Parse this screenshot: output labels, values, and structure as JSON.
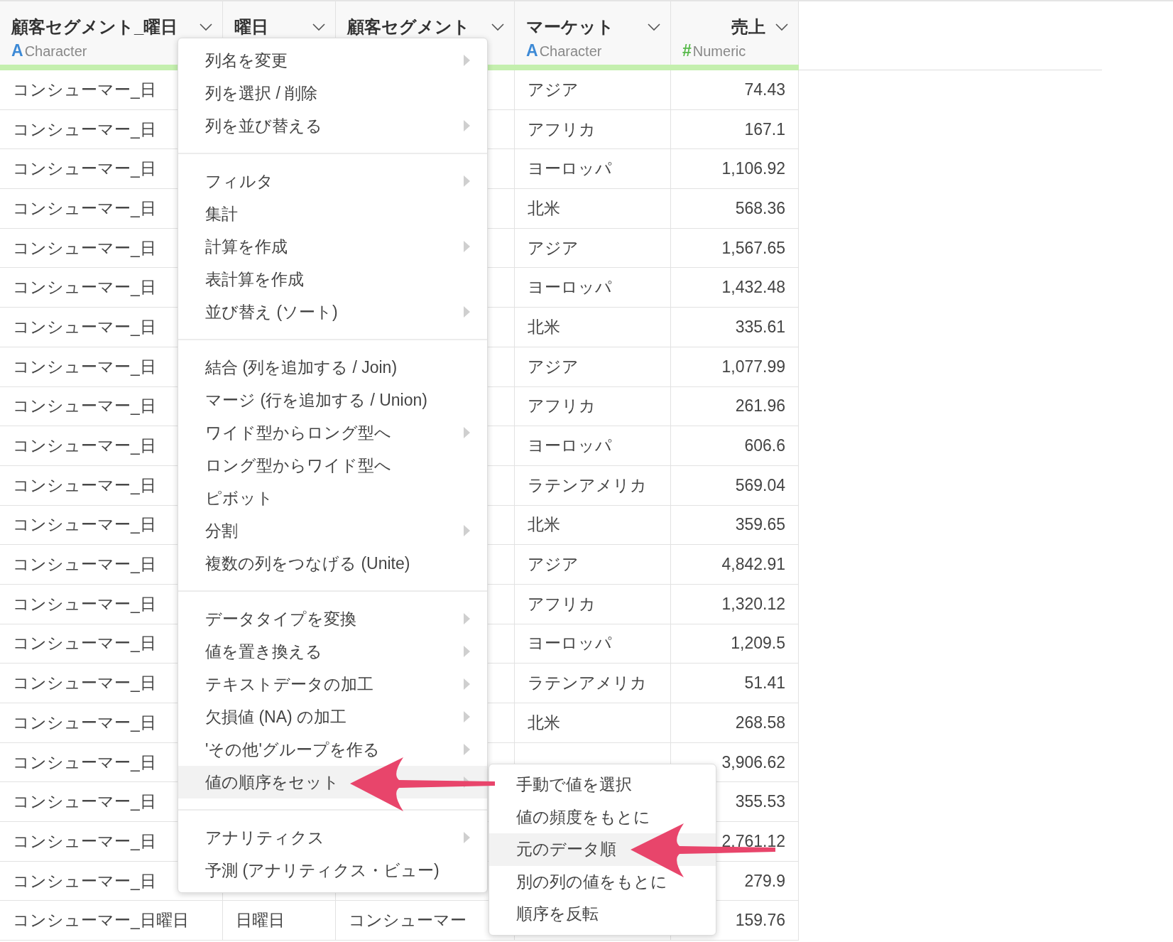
{
  "table": {
    "columns": [
      {
        "name": "顧客セグメント_曜日",
        "type": {
          "kind": "character",
          "icon": "A",
          "label": "Character"
        }
      },
      {
        "name": "曜日"
      },
      {
        "name": "顧客セグメント"
      },
      {
        "name": "マーケット",
        "type": {
          "kind": "character",
          "icon": "A",
          "label": "Character"
        }
      },
      {
        "name": "売上",
        "type": {
          "kind": "numeric",
          "icon": "#",
          "label": "Numeric"
        }
      }
    ],
    "rows": [
      {
        "cells": [
          "コンシューマー_日",
          "",
          "",
          "アジア",
          "74.43"
        ]
      },
      {
        "cells": [
          "コンシューマー_日",
          "",
          "",
          "アフリカ",
          "167.1"
        ]
      },
      {
        "cells": [
          "コンシューマー_日",
          "",
          "",
          "ヨーロッパ",
          "1,106.92"
        ]
      },
      {
        "cells": [
          "コンシューマー_日",
          "",
          "",
          "北米",
          "568.36"
        ]
      },
      {
        "cells": [
          "コンシューマー_日",
          "",
          "",
          "アジア",
          "1,567.65"
        ]
      },
      {
        "cells": [
          "コンシューマー_日",
          "",
          "",
          "ヨーロッパ",
          "1,432.48"
        ]
      },
      {
        "cells": [
          "コンシューマー_日",
          "",
          "",
          "北米",
          "335.61"
        ]
      },
      {
        "cells": [
          "コンシューマー_日",
          "",
          "",
          "アジア",
          "1,077.99"
        ]
      },
      {
        "cells": [
          "コンシューマー_日",
          "",
          "",
          "アフリカ",
          "261.96"
        ]
      },
      {
        "cells": [
          "コンシューマー_日",
          "",
          "",
          "ヨーロッパ",
          "606.6"
        ]
      },
      {
        "cells": [
          "コンシューマー_日",
          "",
          "",
          "ラテンアメリカ",
          "569.04"
        ]
      },
      {
        "cells": [
          "コンシューマー_日",
          "",
          "",
          "北米",
          "359.65"
        ]
      },
      {
        "cells": [
          "コンシューマー_日",
          "",
          "",
          "アジア",
          "4,842.91"
        ]
      },
      {
        "cells": [
          "コンシューマー_日",
          "",
          "",
          "アフリカ",
          "1,320.12"
        ]
      },
      {
        "cells": [
          "コンシューマー_日",
          "",
          "",
          "ヨーロッパ",
          "1,209.5"
        ]
      },
      {
        "cells": [
          "コンシューマー_日",
          "",
          "",
          "ラテンアメリカ",
          "51.41"
        ]
      },
      {
        "cells": [
          "コンシューマー_日",
          "",
          "",
          "北米",
          "268.58"
        ]
      },
      {
        "cells": [
          "コンシューマー_日",
          "",
          "",
          "",
          "3,906.62"
        ]
      },
      {
        "cells": [
          "コンシューマー_日",
          "",
          "",
          "",
          "355.53"
        ]
      },
      {
        "cells": [
          "コンシューマー_日",
          "",
          "",
          "",
          "2,761.12"
        ]
      },
      {
        "cells": [
          "コンシューマー_日",
          "",
          "",
          "",
          "279.9"
        ]
      },
      {
        "cells": [
          "コンシューマー_日曜日",
          "日曜日",
          "コンシューマー",
          "",
          "159.76"
        ]
      }
    ]
  },
  "context_menu": {
    "groups": [
      [
        {
          "label": "列名を変更",
          "submenu": true,
          "selected": false
        },
        {
          "label": "列を選択 / 削除",
          "submenu": false,
          "selected": false
        },
        {
          "label": "列を並び替える",
          "submenu": true,
          "selected": false
        }
      ],
      [
        {
          "label": "フィルタ",
          "submenu": true,
          "selected": false
        },
        {
          "label": "集計",
          "submenu": false,
          "selected": false
        },
        {
          "label": "計算を作成",
          "submenu": true,
          "selected": false
        },
        {
          "label": "表計算を作成",
          "submenu": false,
          "selected": false
        },
        {
          "label": "並び替え (ソート)",
          "submenu": true,
          "selected": false
        }
      ],
      [
        {
          "label": "結合 (列を追加する / Join)",
          "submenu": false,
          "selected": false
        },
        {
          "label": "マージ (行を追加する / Union)",
          "submenu": false,
          "selected": false
        },
        {
          "label": "ワイド型からロング型へ",
          "submenu": true,
          "selected": false
        },
        {
          "label": "ロング型からワイド型へ",
          "submenu": false,
          "selected": false
        },
        {
          "label": "ピボット",
          "submenu": false,
          "selected": false
        },
        {
          "label": "分割",
          "submenu": true,
          "selected": false
        },
        {
          "label": "複数の列をつなげる (Unite)",
          "submenu": false,
          "selected": false
        }
      ],
      [
        {
          "label": "データタイプを変換",
          "submenu": true,
          "selected": false
        },
        {
          "label": "値を置き換える",
          "submenu": true,
          "selected": false
        },
        {
          "label": "テキストデータの加工",
          "submenu": true,
          "selected": false
        },
        {
          "label": "欠損値 (NA) の加工",
          "submenu": true,
          "selected": false
        },
        {
          "label": "'その他'グループを作る",
          "submenu": true,
          "selected": false
        },
        {
          "label": "値の順序をセット",
          "submenu": true,
          "selected": true
        }
      ],
      [
        {
          "label": "アナリティクス",
          "submenu": true,
          "selected": false
        },
        {
          "label": "予測 (アナリティクス・ビュー)",
          "submenu": false,
          "selected": false
        }
      ]
    ]
  },
  "submenu": {
    "items": [
      {
        "label": "手動で値を選択",
        "selected": false
      },
      {
        "label": "値の頻度をもとに",
        "selected": false
      },
      {
        "label": "元のデータ順",
        "selected": true
      },
      {
        "label": "別の列の値をもとに",
        "selected": false
      },
      {
        "label": "順序を反転",
        "selected": false
      }
    ]
  }
}
